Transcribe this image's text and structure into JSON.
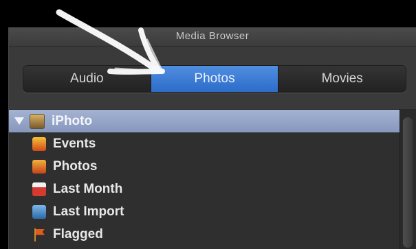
{
  "window": {
    "title": "Media Browser"
  },
  "tabs": [
    {
      "label": "Audio",
      "active": false
    },
    {
      "label": "Photos",
      "active": true
    },
    {
      "label": "Movies",
      "active": false
    }
  ],
  "source_list": {
    "parent": {
      "label": "iPhoto",
      "icon": "iphoto-icon"
    },
    "children": [
      {
        "label": "Events",
        "icon": "events-icon"
      },
      {
        "label": "Photos",
        "icon": "photos-icon"
      },
      {
        "label": "Last Month",
        "icon": "calendar-icon"
      },
      {
        "label": "Last Import",
        "icon": "import-icon"
      },
      {
        "label": "Flagged",
        "icon": "flag-icon"
      }
    ]
  },
  "colors": {
    "accent_selected_tab": "#3b7bd6",
    "selected_row": "#97a6c9",
    "panel_bg": "#3a3a3a",
    "list_bg": "#2f2f2f"
  }
}
